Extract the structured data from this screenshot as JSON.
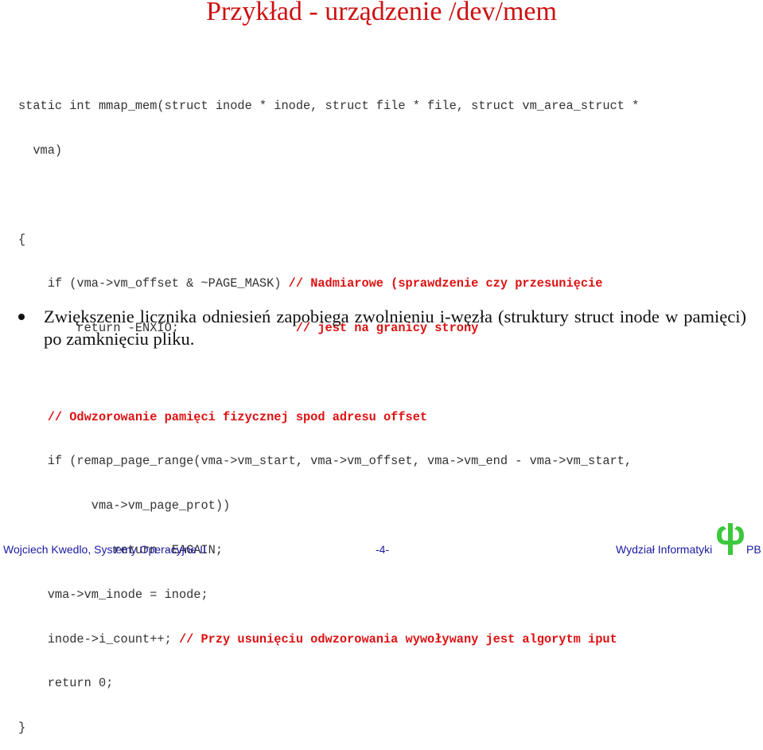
{
  "slide": {
    "title": "Przykład - urządzenie /dev/mem"
  },
  "code": {
    "line1": "static int mmap_mem(struct inode * inode, struct file * file, struct vm_area_struct *",
    "line2": "  vma)",
    "line3": "{",
    "line4_code": "    if (vma->vm_offset & ~PAGE_MASK) ",
    "line4_comment": "// Nadmiarowe (sprawdzenie czy przesunięcie",
    "line5_code": "        return -ENXIO;                ",
    "line5_comment": "// jest na granicy strony",
    "line7_comment": "    // Odwzorowanie pamięci fizycznej spod adresu offset",
    "line8": "    if (remap_page_range(vma->vm_start, vma->vm_offset, vma->vm_end - vma->vm_start,",
    "line9": "          vma->vm_page_prot))",
    "line10": "             return -EAGAIN;",
    "line11": "    vma->vm_inode = inode;",
    "line12_code": "    inode->i_count++; ",
    "line12_comment": "// Przy usunięciu odwzorowania wywoływany jest algorytm iput",
    "line13": "    return 0;",
    "line14": "}"
  },
  "bullet": {
    "text": "Zwiększenie licznika odniesień zapobiega zwolnieniu i-węzła (struktury struct inode w pamięci) po zamknięciu pliku."
  },
  "footer": {
    "left": "Wojciech Kwedlo, Systemy Operacyjne II",
    "center": "-4-",
    "right": "Wydział Informatyki",
    "right_suffix": "PB",
    "logo_icon": "phi-logo-icon"
  },
  "colors": {
    "title": "#cc1111",
    "comment": "#dd1111",
    "code": "#333333",
    "footer": "#1a1aa0",
    "logo": "#3cc83c"
  }
}
